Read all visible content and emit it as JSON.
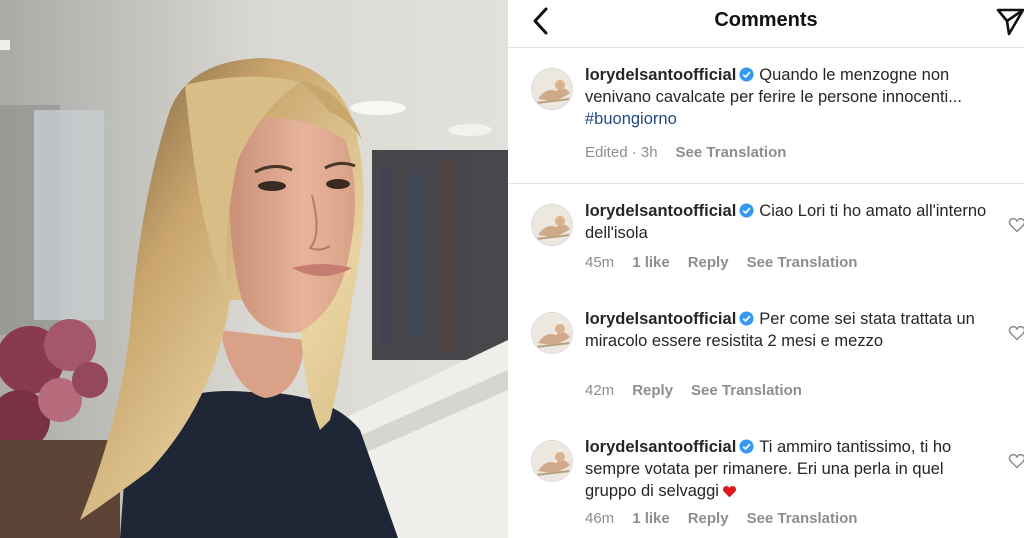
{
  "header": {
    "title": "Comments"
  },
  "caption": {
    "username": "lorydelsantoofficial",
    "text": "Quando le menzogne non venivano cavalcate per ferire le persone innocenti...",
    "hashtag": "#buongiorno",
    "edited": "Edited · 3h",
    "translate": "See Translation"
  },
  "comments": [
    {
      "username": "lorydelsantoofficial",
      "text": "Ciao Lori ti ho amato all'interno dell'isola",
      "time": "45m",
      "likes": "1 like",
      "reply": "Reply",
      "translate": "See Translation"
    },
    {
      "username": "lorydelsantoofficial",
      "text": "Per come sei stata trattata un miracolo essere resistita 2 mesi e mezzo",
      "time": "42m",
      "reply": "Reply",
      "translate": "See Translation"
    },
    {
      "username": "lorydelsantoofficial",
      "text": "Ti ammiro tantissimo, ti ho sempre votata per rimanere. Eri una perla in quel gruppo di selvaggi",
      "emoji": "red-heart",
      "time": "46m",
      "likes": "1 like",
      "reply": "Reply",
      "translate": "See Translation"
    }
  ],
  "icons": {
    "back": "chevron-left-icon",
    "send": "paper-plane-icon",
    "verified": "verified-badge-icon",
    "like": "heart-outline-icon"
  },
  "colors": {
    "verified": "#3897f0",
    "hashtag": "#224a85",
    "muted": "#8e8e8e",
    "heart": "#e0191f"
  }
}
